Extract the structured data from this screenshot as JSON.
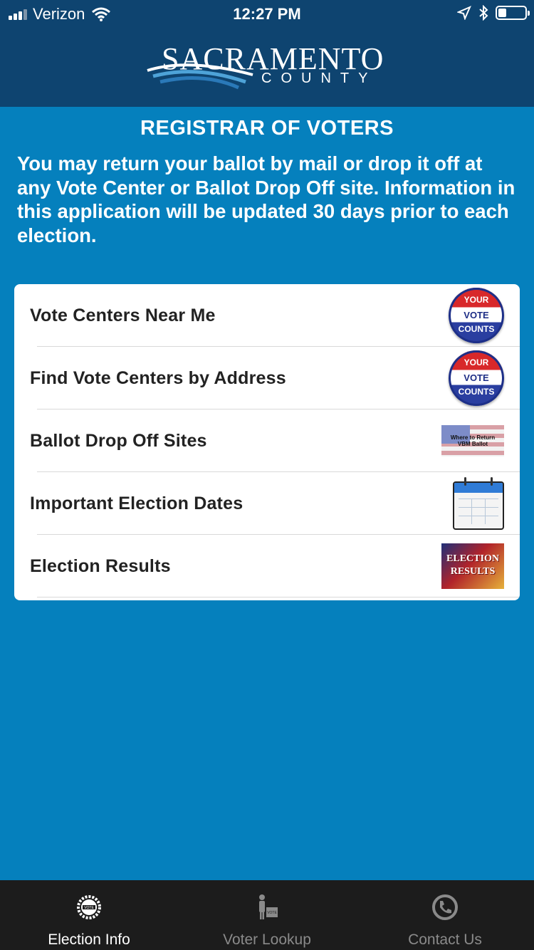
{
  "status_bar": {
    "carrier": "Verizon",
    "time": "12:27 PM",
    "battery_level": 0.3
  },
  "header": {
    "logo_main": "SACRAMENTO",
    "logo_sub": "COUNTY"
  },
  "page": {
    "title": "REGISTRAR OF VOTERS",
    "intro": "You may return your ballot by mail or drop it off at any Vote Center or Ballot Drop Off site. Information in this application will be updated 30 days prior to each election."
  },
  "menu": [
    {
      "label": "Vote Centers Near Me",
      "icon": "your-vote-counts-icon",
      "badge": [
        "YOUR",
        "VOTE",
        "COUNTS"
      ]
    },
    {
      "label": "Find Vote Centers by Address",
      "icon": "your-vote-counts-icon",
      "badge": [
        "YOUR",
        "VOTE",
        "COUNTS"
      ]
    },
    {
      "label": "Ballot Drop Off Sites",
      "icon": "vbm-ballot-flag-icon",
      "badge": [
        "Where to Return",
        "VBM Ballot"
      ]
    },
    {
      "label": "Important Election Dates",
      "icon": "calendar-icon"
    },
    {
      "label": "Election Results",
      "icon": "election-results-icon",
      "badge": [
        "ELECTION",
        "RESULTS"
      ]
    }
  ],
  "tabs": [
    {
      "label": "Election Info",
      "icon": "vote-gear-icon",
      "active": true
    },
    {
      "label": "Voter Lookup",
      "icon": "voter-ballot-icon",
      "active": false
    },
    {
      "label": "Contact Us",
      "icon": "phone-icon",
      "active": false
    }
  ],
  "colors": {
    "header": "#0e4470",
    "background": "#0580bd",
    "card": "#ffffff",
    "tabbar": "#1c1c1c"
  }
}
